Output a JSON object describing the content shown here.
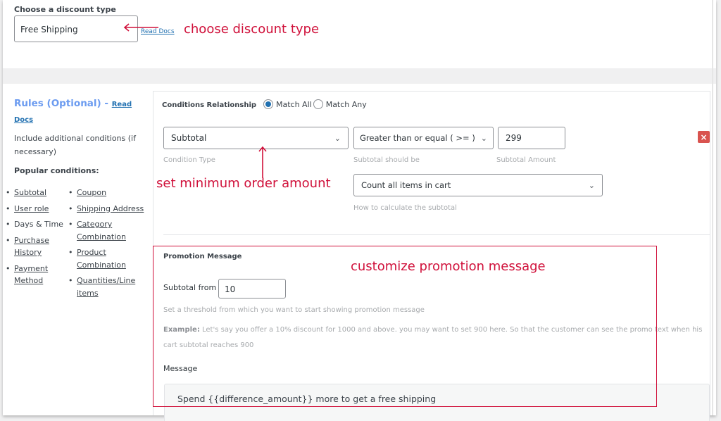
{
  "discount_type": {
    "label": "Choose a discount type",
    "selected": "Free Shipping",
    "read_docs": "Read Docs"
  },
  "annotations": {
    "choose": "choose discount type",
    "minimum": "set minimum order amount",
    "promo": "customize promotion message",
    "color": "#d0103a"
  },
  "rules": {
    "title": "Rules (Optional) - ",
    "read_docs": "Read Docs",
    "description": "Include additional conditions (if necessary)",
    "popular_title": "Popular conditions:",
    "col_a": [
      {
        "label": "Subtotal",
        "link": true
      },
      {
        "label": "User role",
        "link": true
      },
      {
        "label": "Days & Time",
        "link": false
      },
      {
        "label": "Purchase History",
        "link": true
      },
      {
        "label": "Payment Method",
        "link": true
      }
    ],
    "col_b": [
      {
        "label": "Coupon",
        "link": true
      },
      {
        "label": "Shipping Address",
        "link": true
      },
      {
        "label": "Category Combination",
        "link": true
      },
      {
        "label": "Product Combination",
        "link": true
      },
      {
        "label": "Quantities/Line items",
        "link": true
      }
    ]
  },
  "conditions": {
    "relationship_label": "Conditions Relationship",
    "match_all": "Match All",
    "match_any": "Match Any",
    "selected_relationship": "Match All",
    "condition_type": "Subtotal",
    "condition_type_hint": "Condition Type",
    "operator": "Greater than or equal ( >= )",
    "operator_hint": "Subtotal should be",
    "amount": "299",
    "amount_hint": "Subtotal Amount",
    "calc_method": "Count all items in cart",
    "calc_hint": "How to calculate the subtotal",
    "delete_icon": "×",
    "accent": "#2271b1",
    "delete_color": "#d9534f"
  },
  "promotion": {
    "title": "Promotion Message",
    "subtotal_from_label": "Subtotal from",
    "subtotal_from_value": "10",
    "threshold_hint": "Set a threshold from which you want to start showing promotion message",
    "example_label": "Example:",
    "example_text": " Let's say you offer a 10% discount for 1000 and above. you may want to set 900 here. So that the customer can see the promo text when his cart subtotal reaches 900",
    "message_label": "Message",
    "message_value": "Spend {{difference_amount}} more to get a free shipping"
  }
}
